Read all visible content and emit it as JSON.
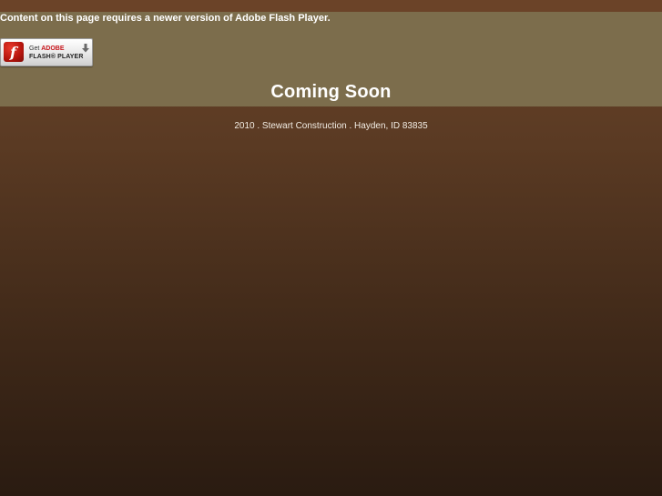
{
  "flash_notice": {
    "message": "Content on this page requires a newer version of Adobe Flash Player.",
    "badge": {
      "get_text": "Get",
      "brand_text": "ADOBE",
      "product_text": "FLASH® PLAYER",
      "logo_letter": "f",
      "icon": "adobe-flash-icon",
      "action_icon": "download-arrow-icon",
      "accent_color": "#c8171d"
    }
  },
  "main": {
    "heading": "Coming Soon"
  },
  "footer": {
    "text": "2010 . Stewart Construction . Hayden, ID 83835"
  },
  "colors": {
    "band": "#7c6d4c",
    "background_top": "#6a4429",
    "background_bottom": "#2a1b11",
    "text": "#ffffff"
  }
}
